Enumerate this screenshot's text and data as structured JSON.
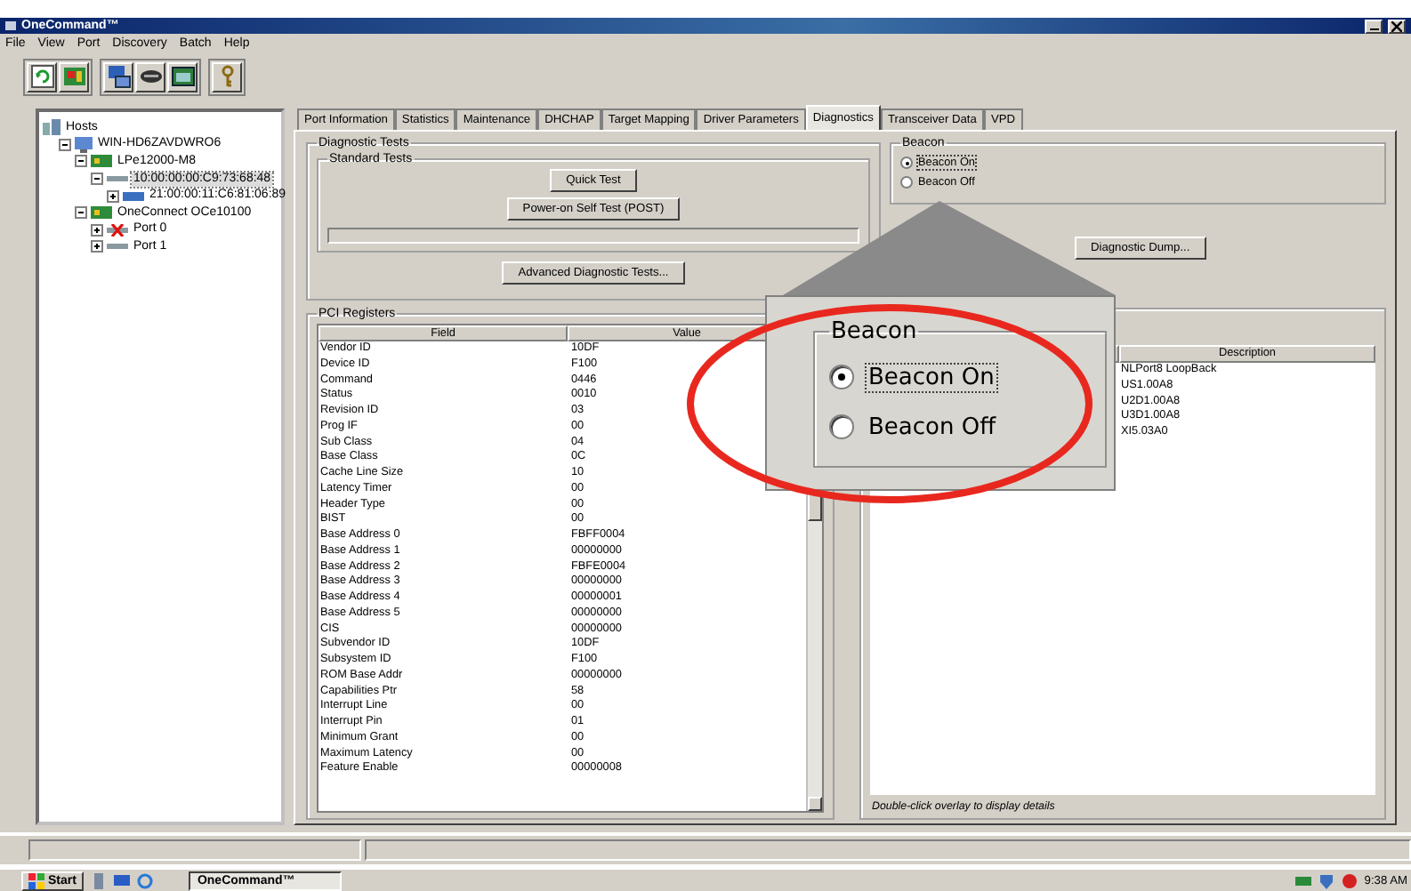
{
  "window": {
    "title": "OneCommand™"
  },
  "menu": [
    "File",
    "View",
    "Port",
    "Discovery",
    "Batch",
    "Help"
  ],
  "tree": [
    {
      "label": "Hosts",
      "kind": "hosts",
      "selected": false,
      "children": [
        {
          "label": "WIN-HD6ZAVDWRO6",
          "kind": "host",
          "expanded": true,
          "selected": false,
          "children": [
            {
              "label": "LPe12000-M8",
              "kind": "adapter",
              "expanded": true,
              "selected": false,
              "children": [
                {
                  "label": "10:00:00:00:C9:73:68:48",
                  "kind": "port",
                  "error": false,
                  "expanded": true,
                  "selected": true,
                  "children": [
                    {
                      "label": "21:00:00:11:C6:81:06:89",
                      "kind": "target",
                      "expanded": false,
                      "selected": false
                    }
                  ]
                }
              ]
            },
            {
              "label": "OneConnect OCe10100",
              "kind": "adapter",
              "expanded": true,
              "selected": false,
              "children": [
                {
                  "label": "Port 0",
                  "kind": "port",
                  "error": true,
                  "expanded": false,
                  "selected": false
                },
                {
                  "label": "Port 1",
                  "kind": "port",
                  "error": false,
                  "expanded": false,
                  "selected": false
                }
              ]
            }
          ]
        }
      ]
    }
  ],
  "tabs": [
    {
      "label": "Port Information",
      "selected": false
    },
    {
      "label": "Statistics",
      "selected": false
    },
    {
      "label": "Maintenance",
      "selected": false
    },
    {
      "label": "DHCHAP",
      "selected": false
    },
    {
      "label": "Target Mapping",
      "selected": false
    },
    {
      "label": "Driver Parameters",
      "selected": false
    },
    {
      "label": "Diagnostics",
      "selected": true
    },
    {
      "label": "Transceiver Data",
      "selected": false
    },
    {
      "label": "VPD",
      "selected": false
    }
  ],
  "diagnostic_tests": {
    "title": "Diagnostic Tests",
    "standard_tests": {
      "title": "Standard Tests",
      "buttons": [
        "Quick Test",
        "Power-on Self Test (POST)"
      ],
      "progress": {
        "level": 0
      }
    },
    "advanced_button": "Advanced Diagnostic Tests..."
  },
  "beacon": {
    "title": "Beacon",
    "options": [
      {
        "label": "Beacon On",
        "selected": true
      },
      {
        "label": "Beacon Off",
        "selected": false
      }
    ]
  },
  "diagnostic_dump_button": "Diagnostic Dump...",
  "zoom_callout": {
    "title": "Beacon",
    "options": [
      {
        "label": "Beacon On",
        "selected": true
      },
      {
        "label": "Beacon Off",
        "selected": false
      }
    ]
  },
  "pci_registers": {
    "title": "PCI Registers",
    "columns": [
      "Field",
      "Value"
    ],
    "rows": [
      [
        "Vendor ID",
        "10DF"
      ],
      [
        "Device ID",
        "F100"
      ],
      [
        "Command",
        "0446"
      ],
      [
        "Status",
        "0010"
      ],
      [
        "Revision ID",
        "03"
      ],
      [
        "Prog IF",
        "00"
      ],
      [
        "Sub Class",
        "04"
      ],
      [
        "Base Class",
        "0C"
      ],
      [
        "Cache Line Size",
        "10"
      ],
      [
        "Latency Timer",
        "00"
      ],
      [
        "Header Type",
        "00"
      ],
      [
        "BIST",
        "00"
      ],
      [
        "Base Address 0",
        "FBFF0004"
      ],
      [
        "Base Address 1",
        "00000000"
      ],
      [
        "Base Address 2",
        "FBFE0004"
      ],
      [
        "Base Address 3",
        "00000000"
      ],
      [
        "Base Address 4",
        "00000001"
      ],
      [
        "Base Address 5",
        "00000000"
      ],
      [
        "CIS",
        "00000000"
      ],
      [
        "Subvendor ID",
        "10DF"
      ],
      [
        "Subsystem ID",
        "F100"
      ],
      [
        "ROM Base Addr",
        "00000000"
      ],
      [
        "Capabilities Ptr",
        "58"
      ],
      [
        "Interrupt Line",
        "00"
      ],
      [
        "Interrupt Pin",
        "01"
      ],
      [
        "Minimum Grant",
        "00"
      ],
      [
        "Maximum Latency",
        "00"
      ],
      [
        "Feature Enable",
        "00000008"
      ]
    ]
  },
  "overlays": {
    "columns": [
      "Description"
    ],
    "rows": [
      "NLPort8 LoopBack",
      "US1.00A8",
      "U2D1.00A8",
      "U3D1.00A8",
      "XI5.03A0"
    ],
    "footer": "Double-click overlay to display details"
  },
  "taskbar": {
    "start": "Start",
    "tasks": [
      {
        "label": "OneCommand™",
        "selected": true
      }
    ],
    "clock": "9:38 AM"
  }
}
